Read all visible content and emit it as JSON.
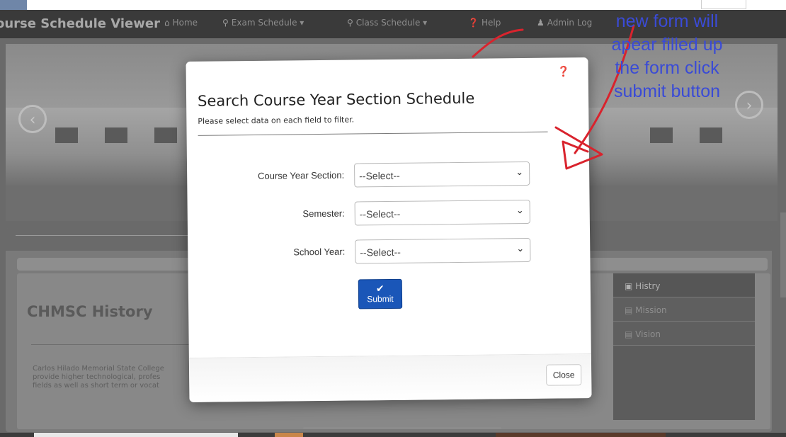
{
  "navbar": {
    "brand": "ourse Schedule Viewer",
    "items": [
      {
        "label": "Home",
        "icon": "home-icon"
      },
      {
        "label": "Exam Schedule ▾",
        "icon": "search-icon"
      },
      {
        "label": "Class Schedule ▾",
        "icon": "search-icon"
      },
      {
        "label": "Help",
        "icon": "question-circle-icon"
      },
      {
        "label": "Admin Log",
        "icon": "user-icon"
      }
    ]
  },
  "background": {
    "history_title": "CHMSC History",
    "history_text": [
      "Carlos Hilado Memorial State College",
      "provide higher technological, profes",
      "fields as well as short term or vocat"
    ],
    "sidenav": [
      "Histry",
      "Mission",
      "Vision"
    ]
  },
  "modal": {
    "title": "Search Course Year Section Schedule",
    "subtitle": "Please select data on each field to filter.",
    "fields": [
      {
        "label": "Course Year Section:",
        "value": "--Select--"
      },
      {
        "label": "Semester:",
        "value": "--Select--"
      },
      {
        "label": "School Year:",
        "value": "--Select--"
      }
    ],
    "submit_label": "Submit",
    "close_label": "Close"
  },
  "annotation": {
    "lines": [
      "new form will",
      "apear filled up",
      "the form click",
      "submit button"
    ],
    "color": "#3a4bd6",
    "arrow_color": "#d9232d"
  },
  "colors": {
    "primary_button": "#1a56b8",
    "overlay_dim": "#5c5c5c"
  }
}
